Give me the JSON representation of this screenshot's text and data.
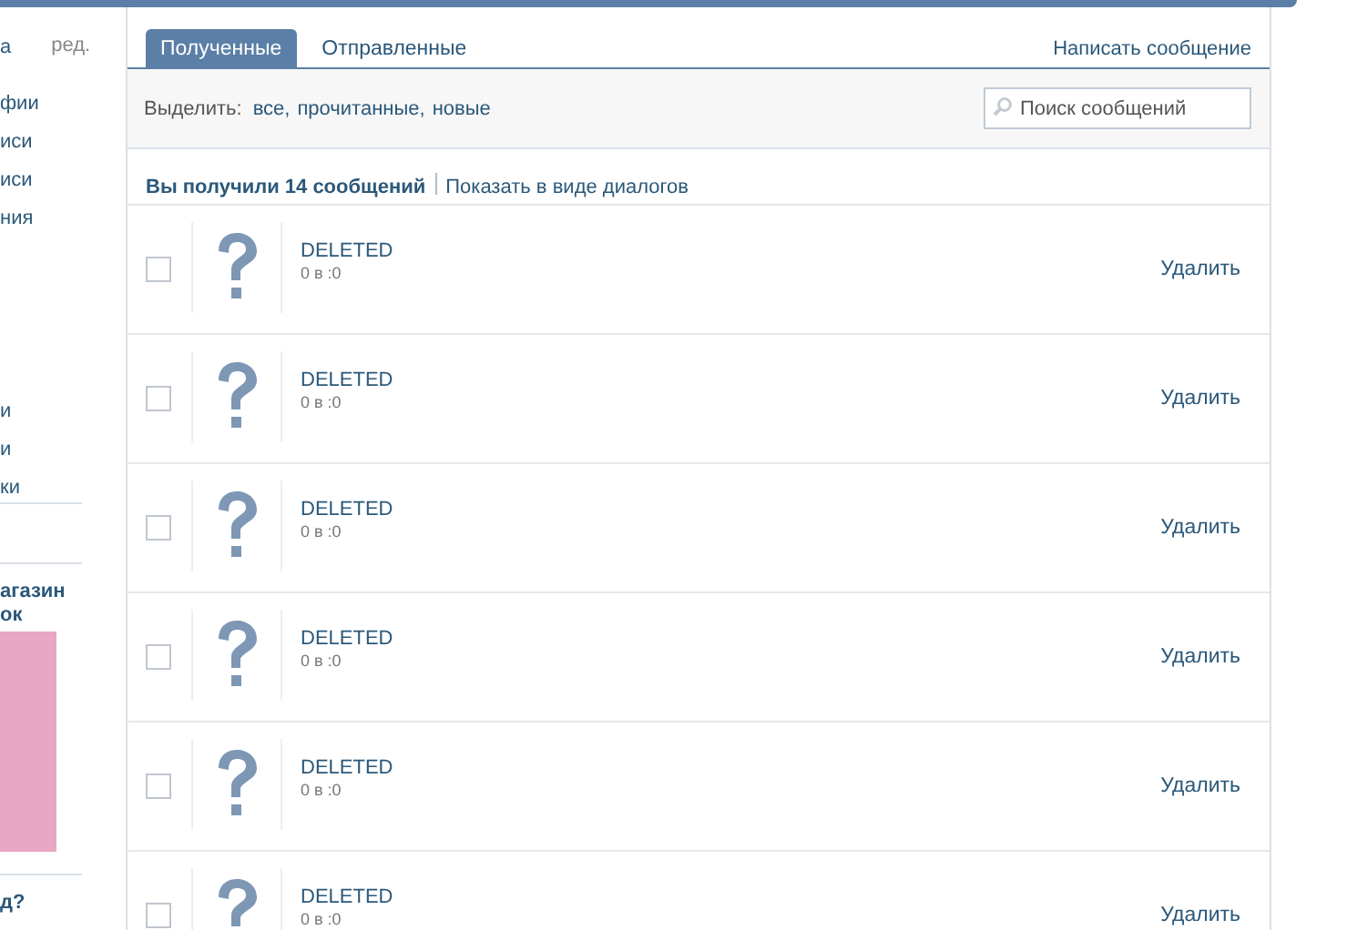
{
  "sidebar": {
    "header": {
      "text": "а",
      "edit": "ред."
    },
    "menu_groups": [
      [
        "фии",
        "иси",
        "иси",
        "ния"
      ],
      [
        "и",
        "и",
        "ки"
      ]
    ],
    "promo": {
      "title": "агазин ок"
    },
    "next_heading": "д?"
  },
  "tabs": [
    {
      "label": "Полученные",
      "selected": true
    },
    {
      "label": "Отправленные",
      "selected": false
    }
  ],
  "compose_link": "Написать сообщение",
  "filter": {
    "label": "Выделить:",
    "options": [
      "все,",
      "прочитанные,",
      "новые"
    ]
  },
  "search": {
    "placeholder": "Поиск сообщений"
  },
  "summary": {
    "count_text": "Вы получили 14 сообщений",
    "dialogs_link": "Показать в виде диалогов"
  },
  "messages": [
    {
      "sender": "DELETED",
      "date": "0 в :0",
      "action": "Удалить",
      "checked": false
    },
    {
      "sender": "DELETED",
      "date": "0 в :0",
      "action": "Удалить",
      "checked": false
    },
    {
      "sender": "DELETED",
      "date": "0 в :0",
      "action": "Удалить",
      "checked": false
    },
    {
      "sender": "DELETED",
      "date": "0 в :0",
      "action": "Удалить",
      "checked": false
    },
    {
      "sender": "DELETED",
      "date": "0 в :0",
      "action": "Удалить",
      "checked": false
    },
    {
      "sender": "DELETED",
      "date": "0 в :0",
      "action": "Удалить",
      "checked": false
    }
  ]
}
